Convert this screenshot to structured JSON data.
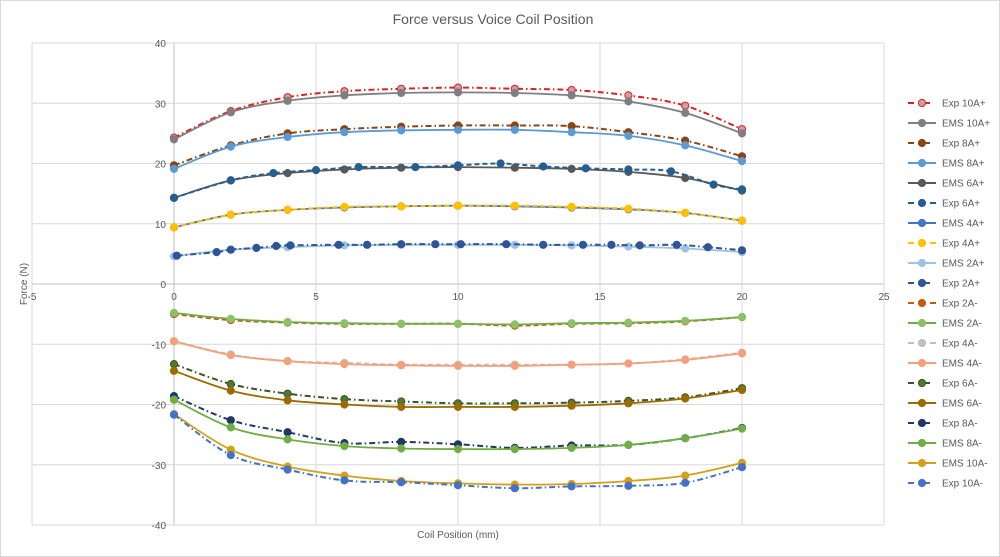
{
  "chart_data": {
    "type": "scatter",
    "title": "Force versus Voice Coil Position",
    "xlabel": "Coil Position (mm)",
    "ylabel": "Force (N)",
    "xlim": [
      -5,
      25
    ],
    "ylim": [
      -40,
      40
    ],
    "xticks": [
      -5,
      0,
      5,
      10,
      15,
      20,
      25
    ],
    "yticks": [
      40,
      30,
      20,
      10,
      0,
      -10,
      -20,
      -30,
      -40
    ],
    "grid": true,
    "legend_position": "right",
    "series": [
      {
        "name": "Exp 10A+",
        "color": "#e02020",
        "dash": "dashdot",
        "marker_fill": "#c9a0a6",
        "marker_stroke": "#e02020",
        "x": [
          0,
          2,
          4,
          6,
          8,
          10,
          12,
          14,
          16,
          18,
          20
        ],
        "y": [
          24.3,
          28.7,
          31.0,
          32.0,
          32.4,
          32.6,
          32.4,
          32.2,
          31.3,
          29.6,
          25.7
        ]
      },
      {
        "name": "EMS 10A+",
        "color": "#7f7f7f",
        "dash": "solid",
        "marker_fill": "#7f7f7f",
        "marker_stroke": "#7f7f7f",
        "x": [
          0,
          2,
          4,
          6,
          8,
          10,
          12,
          14,
          16,
          18,
          20
        ],
        "y": [
          24.0,
          28.5,
          30.4,
          31.3,
          31.7,
          31.8,
          31.7,
          31.3,
          30.3,
          28.4,
          25.0
        ]
      },
      {
        "name": "Exp 8A+",
        "color": "#8b4513",
        "dash": "dashdot",
        "marker_fill": "#8b4513",
        "marker_stroke": "#8b4513",
        "x": [
          0,
          2,
          4,
          6,
          8,
          10,
          12,
          14,
          16,
          18,
          20
        ],
        "y": [
          19.7,
          23.0,
          25.0,
          25.7,
          26.1,
          26.3,
          26.3,
          26.2,
          25.2,
          23.8,
          21.2
        ]
      },
      {
        "name": "EMS 8A+",
        "color": "#5b9bd5",
        "dash": "solid",
        "marker_fill": "#5b9bd5",
        "marker_stroke": "#5b9bd5",
        "x": [
          0,
          2,
          4,
          6,
          8,
          10,
          12,
          14,
          16,
          18,
          20
        ],
        "y": [
          19.1,
          22.8,
          24.4,
          25.2,
          25.5,
          25.6,
          25.6,
          25.2,
          24.6,
          23.0,
          20.4
        ]
      },
      {
        "name": "EMS 6A+",
        "color": "#595959",
        "dash": "solid",
        "marker_fill": "#595959",
        "marker_stroke": "#595959",
        "x": [
          0,
          2,
          4,
          6,
          8,
          10,
          12,
          14,
          16,
          18,
          20
        ],
        "y": [
          14.3,
          17.2,
          18.4,
          19.0,
          19.3,
          19.4,
          19.3,
          19.1,
          18.6,
          17.6,
          15.5
        ]
      },
      {
        "name": "Exp 6A+",
        "color": "#255e91",
        "dash": "dash",
        "marker_fill": "#255e91",
        "marker_stroke": "#255e91",
        "x": [
          0,
          2,
          3.5,
          5,
          6.5,
          8.5,
          10,
          11.5,
          13,
          14.5,
          16,
          17.5,
          19,
          20
        ],
        "y": [
          14.3,
          17.2,
          18.4,
          18.9,
          19.4,
          19.4,
          19.7,
          20.0,
          19.5,
          19.2,
          19.0,
          18.7,
          16.5,
          15.7
        ]
      },
      {
        "name": "EMS 4A+",
        "color": "#4472c4",
        "dash": "solid",
        "marker_fill": "#4472c4",
        "marker_stroke": "#4472c4",
        "x": [
          0,
          2,
          4,
          6,
          8,
          10,
          12,
          14,
          16,
          18,
          20
        ],
        "y": [
          9.4,
          11.5,
          12.3,
          12.7,
          12.9,
          13.0,
          12.9,
          12.7,
          12.4,
          11.8,
          10.5
        ]
      },
      {
        "name": "Exp 4A+",
        "color": "#ffc000",
        "dash": "dash",
        "marker_fill": "#ffc000",
        "marker_stroke": "#ffc000",
        "x": [
          0,
          2,
          4,
          6,
          8,
          10,
          12,
          14,
          16,
          18,
          20
        ],
        "y": [
          9.4,
          11.5,
          12.3,
          12.8,
          12.9,
          13.0,
          13.0,
          12.8,
          12.5,
          11.8,
          10.5
        ]
      },
      {
        "name": "EMS 2A+",
        "color": "#9dc3e6",
        "dash": "solid",
        "marker_fill": "#9dc3e6",
        "marker_stroke": "#9dc3e6",
        "x": [
          0,
          2,
          4,
          6,
          8,
          10,
          12,
          14,
          16,
          18,
          20
        ],
        "y": [
          4.6,
          5.7,
          6.1,
          6.4,
          6.5,
          6.5,
          6.5,
          6.4,
          6.2,
          5.9,
          5.3
        ]
      },
      {
        "name": "Exp 2A+",
        "color": "#2f5597",
        "dash": "dashdot",
        "marker_fill": "#2f5597",
        "marker_stroke": "#2f5597",
        "x": [
          0.1,
          1.5,
          2,
          2.9,
          3.6,
          4.1,
          5.8,
          6.8,
          8,
          9.2,
          10.1,
          11.7,
          13,
          14.4,
          15.4,
          16.4,
          17.7,
          18.8,
          20
        ],
        "y": [
          4.7,
          5.3,
          5.7,
          6.0,
          6.3,
          6.4,
          6.5,
          6.5,
          6.6,
          6.6,
          6.6,
          6.6,
          6.5,
          6.5,
          6.5,
          6.4,
          6.5,
          6.1,
          5.6
        ]
      },
      {
        "name": "Exp 2A-",
        "color": "#c55a11",
        "dash": "dash",
        "marker_fill": "#c55a11",
        "marker_stroke": "#c55a11",
        "x": [
          0,
          2,
          4,
          6,
          8,
          10,
          12,
          14,
          16,
          18,
          20
        ],
        "y": [
          -5.0,
          -6.0,
          -6.4,
          -6.6,
          -6.6,
          -6.6,
          -6.9,
          -6.6,
          -6.5,
          -6.2,
          -5.5
        ]
      },
      {
        "name": "EMS 2A-",
        "color": "#70ad47",
        "dash": "solid",
        "marker_fill": "#8cc168",
        "marker_stroke": "#8cc168",
        "x": [
          0,
          2,
          4,
          6,
          8,
          10,
          12,
          14,
          16,
          18,
          20
        ],
        "y": [
          -4.8,
          -5.8,
          -6.3,
          -6.5,
          -6.6,
          -6.6,
          -6.7,
          -6.5,
          -6.4,
          -6.1,
          -5.5
        ]
      },
      {
        "name": "Exp 4A-",
        "color": "#bfbfbf",
        "dash": "dash",
        "marker_fill": "#bfbfbf",
        "marker_stroke": "#bfbfbf",
        "x": [
          0,
          2,
          4,
          6,
          8,
          10,
          12,
          14,
          16,
          18,
          20
        ],
        "y": [
          -9.5,
          -11.7,
          -12.8,
          -13.1,
          -13.4,
          -13.4,
          -13.4,
          -13.4,
          -13.2,
          -12.5,
          -11.4
        ]
      },
      {
        "name": "EMS 4A-",
        "color": "#f4a07a",
        "dash": "solid",
        "marker_fill": "#f4a07a",
        "marker_stroke": "#f4a07a",
        "x": [
          0,
          2,
          4,
          6,
          8,
          10,
          12,
          14,
          16,
          18,
          20
        ],
        "y": [
          -9.5,
          -11.8,
          -12.8,
          -13.3,
          -13.5,
          -13.6,
          -13.6,
          -13.4,
          -13.2,
          -12.6,
          -11.5
        ]
      },
      {
        "name": "Exp 6A-",
        "color": "#375623",
        "dash": "dashdot",
        "marker_fill": "#4e7a2e",
        "marker_stroke": "#375623",
        "x": [
          0,
          2,
          4,
          6,
          8,
          10,
          12,
          14,
          16,
          18,
          20
        ],
        "y": [
          -13.3,
          -16.6,
          -18.2,
          -19.1,
          -19.5,
          -19.8,
          -19.8,
          -19.7,
          -19.4,
          -18.8,
          -17.3
        ]
      },
      {
        "name": "EMS 6A-",
        "color": "#9c6b00",
        "dash": "solid",
        "marker_fill": "#9c6b00",
        "marker_stroke": "#9c6b00",
        "x": [
          0,
          2,
          4,
          6,
          8,
          10,
          12,
          14,
          16,
          18,
          20
        ],
        "y": [
          -14.4,
          -17.7,
          -19.3,
          -20.0,
          -20.4,
          -20.4,
          -20.4,
          -20.2,
          -19.8,
          -19.0,
          -17.6
        ]
      },
      {
        "name": "Exp 8A-",
        "color": "#203864",
        "dash": "dashdot",
        "marker_fill": "#203864",
        "marker_stroke": "#203864",
        "x": [
          0,
          2,
          4,
          6,
          8,
          10,
          12,
          14,
          16,
          18,
          20
        ],
        "y": [
          -18.6,
          -22.6,
          -24.6,
          -26.4,
          -26.2,
          -26.6,
          -27.2,
          -26.8,
          -26.7,
          -25.6,
          -23.9
        ]
      },
      {
        "name": "EMS 8A-",
        "color": "#70ad47",
        "dash": "solid",
        "marker_fill": "#70ad47",
        "marker_stroke": "#70ad47",
        "x": [
          0,
          2,
          4,
          6,
          8,
          10,
          12,
          14,
          16,
          18,
          20
        ],
        "y": [
          -19.2,
          -23.8,
          -25.8,
          -26.9,
          -27.3,
          -27.4,
          -27.4,
          -27.2,
          -26.7,
          -25.6,
          -24.0
        ]
      },
      {
        "name": "EMS 10A-",
        "color": "#d4a017",
        "dash": "solid",
        "marker_fill": "#d4a017",
        "marker_stroke": "#d4a017",
        "x": [
          0,
          2,
          4,
          6,
          8,
          10,
          12,
          14,
          16,
          18,
          20
        ],
        "y": [
          -21.6,
          -27.5,
          -30.3,
          -31.8,
          -32.7,
          -33.1,
          -33.3,
          -33.2,
          -32.7,
          -31.8,
          -29.7
        ]
      },
      {
        "name": "Exp 10A-",
        "color": "#4472c4",
        "dash": "dashdot",
        "marker_fill": "#4472c4",
        "marker_stroke": "#4472c4",
        "x": [
          0,
          2,
          4,
          6,
          8,
          10,
          12,
          14,
          16,
          18,
          20
        ],
        "y": [
          -21.7,
          -28.4,
          -30.8,
          -32.6,
          -32.9,
          -33.4,
          -33.9,
          -33.6,
          -33.5,
          -33.0,
          -30.4
        ]
      }
    ]
  }
}
